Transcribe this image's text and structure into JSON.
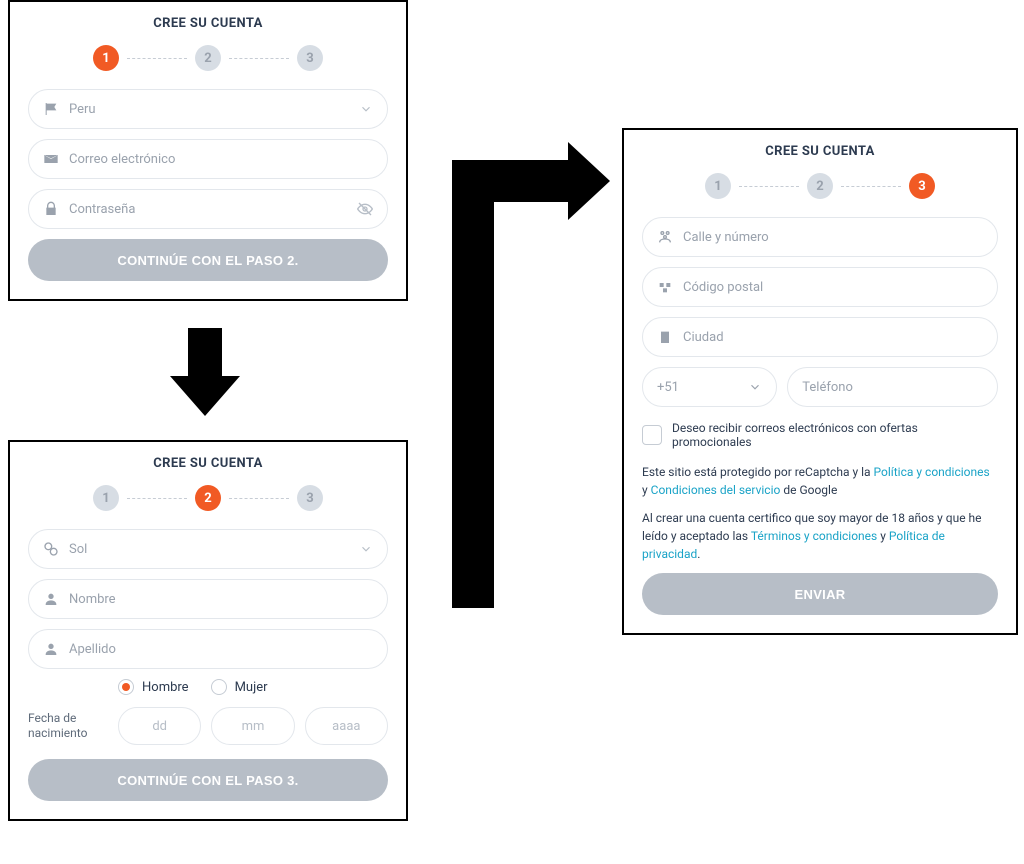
{
  "title": "CREE SU CUENTA",
  "step1": {
    "steps": [
      "1",
      "2",
      "3"
    ],
    "active": 0,
    "country": "Peru",
    "email_ph": "Correo electrónico",
    "password_ph": "Contraseña",
    "continue": "CONTINÚE CON EL PASO 2."
  },
  "step2": {
    "steps": [
      "1",
      "2",
      "3"
    ],
    "active": 1,
    "currency": "Sol",
    "firstname_ph": "Nombre",
    "lastname_ph": "Apellido",
    "gender_male": "Hombre",
    "gender_female": "Mujer",
    "dob_label": "Fecha de nacimiento",
    "dd": "dd",
    "mm": "mm",
    "yyyy": "aaaa",
    "continue": "CONTINÚE CON EL PASO 3."
  },
  "step3": {
    "steps": [
      "1",
      "2",
      "3"
    ],
    "active": 2,
    "street_ph": "Calle y número",
    "zip_ph": "Código postal",
    "city_ph": "Ciudad",
    "phone_prefix": "+51",
    "phone_ph": "Teléfono",
    "promo_label": "Deseo recibir correos electrónicos con ofertas promocionales",
    "recaptcha_pre": "Este sitio está protegido por reCaptcha y la ",
    "recaptcha_link1": "Política y condiciones",
    "recaptcha_mid": " y ",
    "recaptcha_link2": "Condiciones del servicio",
    "recaptcha_post": " de Google",
    "age_pre": "Al crear una cuenta certifico que soy mayor de 18 años y que he leído y aceptado las ",
    "age_link1": "Términos y condiciones",
    "age_mid": " y ",
    "age_link2": "Política de privacidad",
    "age_post": ".",
    "submit": "ENVIAR"
  }
}
